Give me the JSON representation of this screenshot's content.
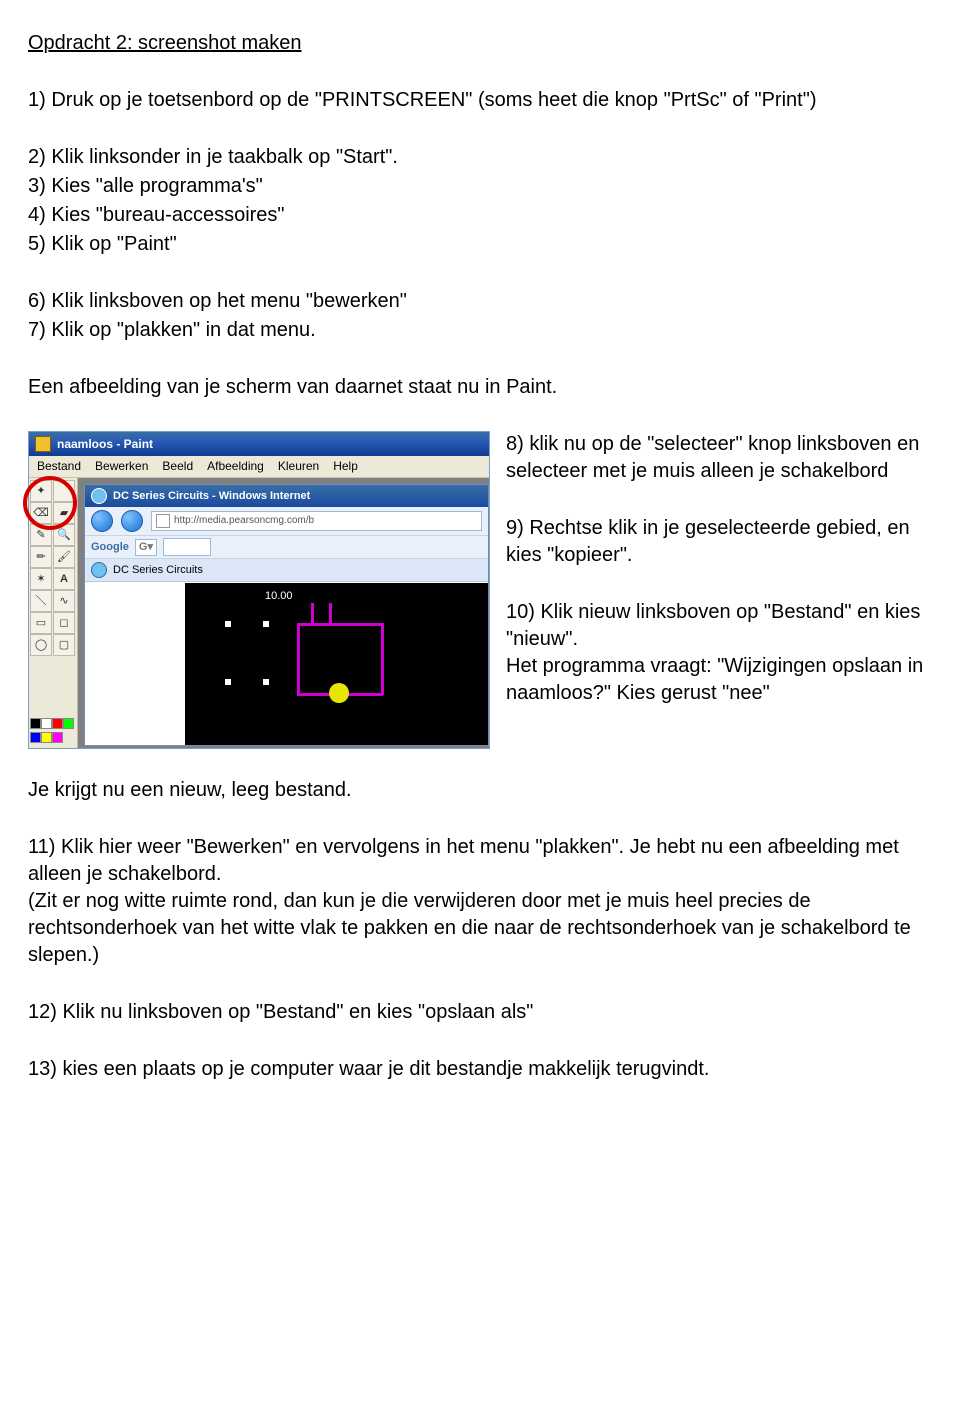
{
  "title": "Opdracht 2: screenshot maken",
  "step1": "1) Druk op je toetsenbord op de \"PRINTSCREEN\" (soms heet die knop \"PrtSc\" of \"Print\")",
  "step2": "2) Klik linksonder in je taakbalk op \"Start\".",
  "steps345": [
    "3) Kies \"alle programma's\"",
    "4) Kies \"bureau-accessoires\"",
    "5) Klik op \"Paint\""
  ],
  "steps67": [
    "6) Klik linksboven op het menu \"bewerken\"",
    "7) Klik op \"plakken\" in dat menu."
  ],
  "afterText": "Een afbeelding van je scherm van daarnet staat nu in Paint.",
  "side8": "8) klik nu op de \"selecteer\" knop linksboven en selecteer met je muis alleen je schakelbord",
  "side9": "9) Rechtse klik in je geselecteerde gebied, en kies \"kopieer\".",
  "side10": "10) Klik nieuw linksboven op \"Bestand\" en kies \"nieuw\".\nHet programma vraagt: \"Wijzigingen opslaan in naamloos?\" Kies gerust \"nee\"",
  "afterImg": "Je krijgt nu een nieuw, leeg bestand.",
  "step11": "11) Klik hier weer \"Bewerken\" en vervolgens in het menu \"plakken\". Je hebt nu een afbeelding met alleen je schakelbord.\n(Zit er nog witte ruimte rond, dan kun je die verwijderen door met je muis heel precies de rechtsonderhoek van het witte vlak te pakken en die naar de rechtsonderhoek van je schakelbord te slepen.)",
  "step12": "12) Klik nu linksboven op \"Bestand\" en kies \"opslaan als\"",
  "step13": "13) kies een plaats op je computer waar je dit bestandje makkelijk terugvindt.",
  "paint": {
    "title": "naamloos - Paint",
    "menus": [
      "Bestand",
      "Bewerken",
      "Beeld",
      "Afbeelding",
      "Kleuren",
      "Help"
    ],
    "browserTitle": "DC Series Circuits - Windows Internet",
    "url": "http://media.pearsoncmg.com/b",
    "google": "Google",
    "gprefix": "G",
    "tab": "DC Series Circuits",
    "circuitValue": "10.00"
  }
}
